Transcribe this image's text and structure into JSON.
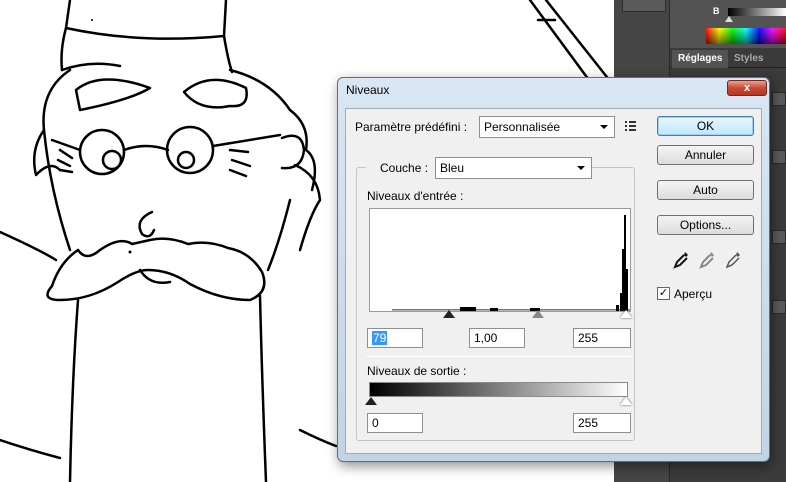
{
  "photoshop_panel": {
    "channel_label": "B",
    "tabs": [
      "Réglages",
      "Styles"
    ]
  },
  "dialog": {
    "title": "Niveaux",
    "close_label": "x",
    "preset": {
      "label": "Paramètre prédéfini :",
      "value": "Personnalisée"
    },
    "channel": {
      "label": "Couche :",
      "value": "Bleu"
    },
    "input_levels": {
      "label": "Niveaux d'entrée :",
      "black": "79",
      "gamma": "1,00",
      "white": "255"
    },
    "output_levels": {
      "label": "Niveaux de sortie :",
      "black": "0",
      "white": "255"
    },
    "buttons": {
      "ok": "OK",
      "cancel": "Annuler",
      "auto": "Auto",
      "options": "Options..."
    },
    "preview": {
      "label": "Aperçu",
      "checked": true
    },
    "eyedroppers": [
      "eyedropper-black-icon",
      "eyedropper-gray-icon",
      "eyedropper-white-icon"
    ]
  }
}
